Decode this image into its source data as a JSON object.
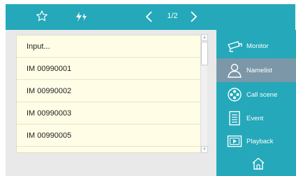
{
  "topbar": {
    "favorite_icon": "star-outline-icon",
    "flash_icon": "lightning-icon",
    "page_indicator": "1/2"
  },
  "list": {
    "rows": [
      {
        "label": "Input..."
      },
      {
        "label": "IM 00990001"
      },
      {
        "label": "IM 00990002"
      },
      {
        "label": "IM 00990003"
      },
      {
        "label": "IM 00990005"
      }
    ]
  },
  "sidebar": {
    "items": [
      {
        "label": "Monitor",
        "icon": "camera-icon",
        "active": false
      },
      {
        "label": "Namelist",
        "icon": "person-icon",
        "active": true
      },
      {
        "label": "Call scene",
        "icon": "call-scene-icon",
        "active": false
      },
      {
        "label": "Event",
        "icon": "event-list-icon",
        "active": false
      },
      {
        "label": "Playback",
        "icon": "playback-icon",
        "active": false
      }
    ],
    "home_icon": "home-icon"
  },
  "colors": {
    "accent": "#24a8ba",
    "active": "#7c98a8",
    "list_bg": "#fffde6",
    "panel_bg": "#e9e9e9"
  }
}
